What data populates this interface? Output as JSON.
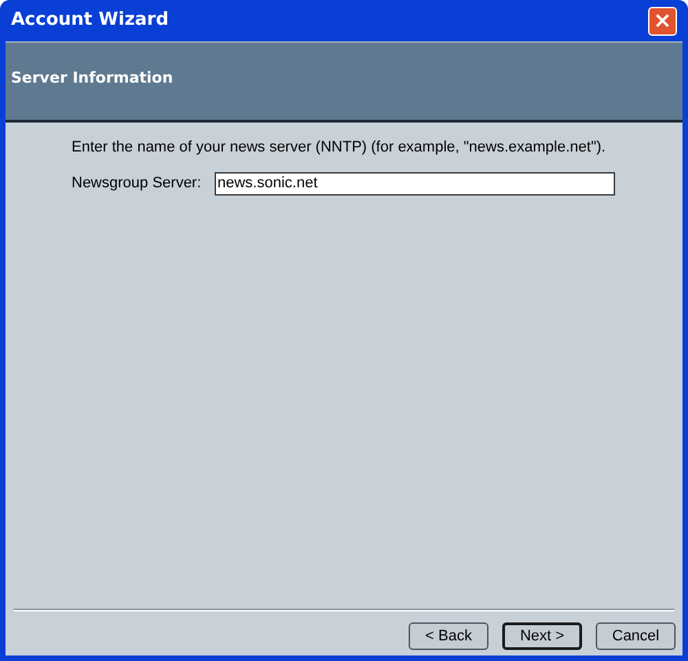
{
  "window": {
    "title": "Account Wizard",
    "close_button": "×"
  },
  "header": {
    "title": "Server Information"
  },
  "instructions": "Enter the name of your news server (NNTP) (for example, \"news.example.net\").",
  "server_field": {
    "label": "Newsgroup Server:",
    "value": "news.sonic.net"
  },
  "buttons": [
    {
      "label": "< Back",
      "default": false
    },
    {
      "label": "Next >",
      "default": true
    },
    {
      "label": "Cancel",
      "default": false
    }
  ]
}
